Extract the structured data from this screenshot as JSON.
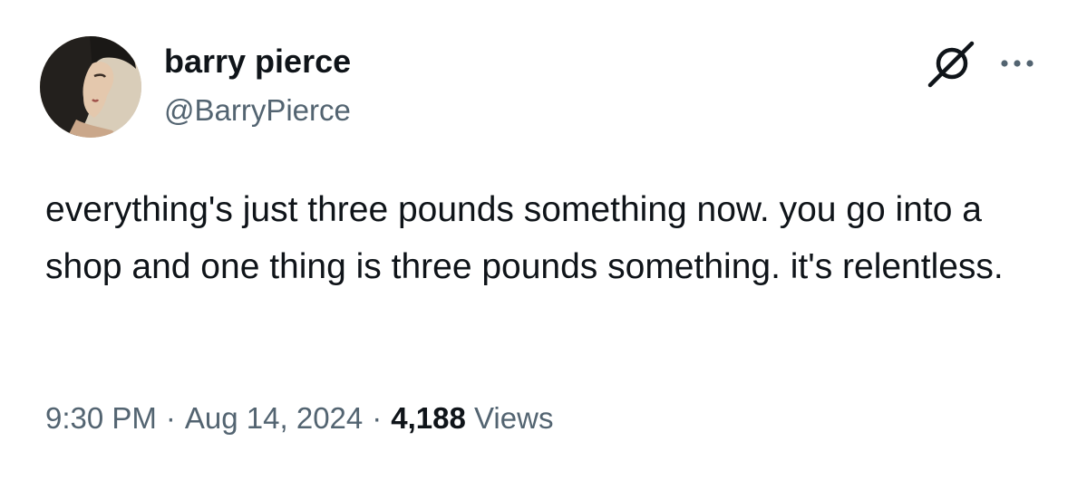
{
  "author": {
    "display_name": "barry pierce",
    "handle": "@BarryPierce"
  },
  "tweet": {
    "text": "everything's just three pounds something now. you go into a shop and one thing is three pounds something. it's relentless."
  },
  "meta": {
    "time": "9:30 PM",
    "date": "Aug 14, 2024",
    "separator": "·",
    "views_count": "4,188",
    "views_label": "Views"
  },
  "icons": {
    "grok": "grok-icon",
    "more": "more-icon"
  },
  "colors": {
    "text_primary": "#0f1419",
    "text_secondary": "#536471",
    "background": "#ffffff"
  }
}
